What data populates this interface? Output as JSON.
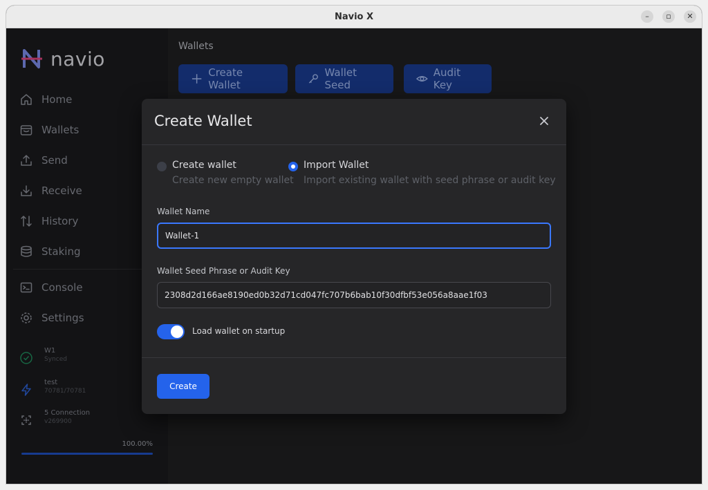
{
  "window": {
    "title": "Navio X"
  },
  "brand": {
    "name": "navio"
  },
  "nav": {
    "items": [
      {
        "label": "Home",
        "icon": "home-icon"
      },
      {
        "label": "Wallets",
        "icon": "wallet-icon"
      },
      {
        "label": "Send",
        "icon": "upload-icon"
      },
      {
        "label": "Receive",
        "icon": "download-icon"
      },
      {
        "label": "History",
        "icon": "arrows-up-down-icon"
      },
      {
        "label": "Staking",
        "icon": "database-icon"
      },
      {
        "label": "Console",
        "icon": "terminal-icon"
      },
      {
        "label": "Settings",
        "icon": "gear-icon"
      }
    ]
  },
  "status": {
    "wallet": {
      "name": "W1",
      "state": "Synced"
    },
    "sync": {
      "name": "test",
      "blocks": "70781/70781"
    },
    "network": {
      "connections": "5 Connection",
      "version": "v269900"
    },
    "progress": {
      "label": "100.00%",
      "value": 1.0
    }
  },
  "main": {
    "breadcrumb": "Wallets",
    "toolbar": {
      "create_wallet": "Create Wallet",
      "wallet_seed": "Wallet Seed",
      "audit_key": "Audit Key"
    }
  },
  "modal": {
    "title": "Create Wallet",
    "options": {
      "create": {
        "label": "Create wallet",
        "description": "Create new empty wallet",
        "selected": false
      },
      "import": {
        "label": "Import Wallet",
        "description": "Import existing wallet with seed phrase or audit key",
        "selected": true
      }
    },
    "wallet_name_label": "Wallet Name",
    "wallet_name_value": "Wallet-1",
    "seed_label": "Wallet Seed Phrase or Audit Key",
    "seed_value": "2308d2d166ae8190ed0b32d71cd047fc707b6bab10f30dfbf53e056a8aae1f03",
    "load_on_startup_label": "Load wallet on startup",
    "load_on_startup": true,
    "submit_label": "Create"
  },
  "colors": {
    "accent": "#2463eb",
    "toolbar_button": "#1a3b8f",
    "synced": "#1f8a5b"
  }
}
